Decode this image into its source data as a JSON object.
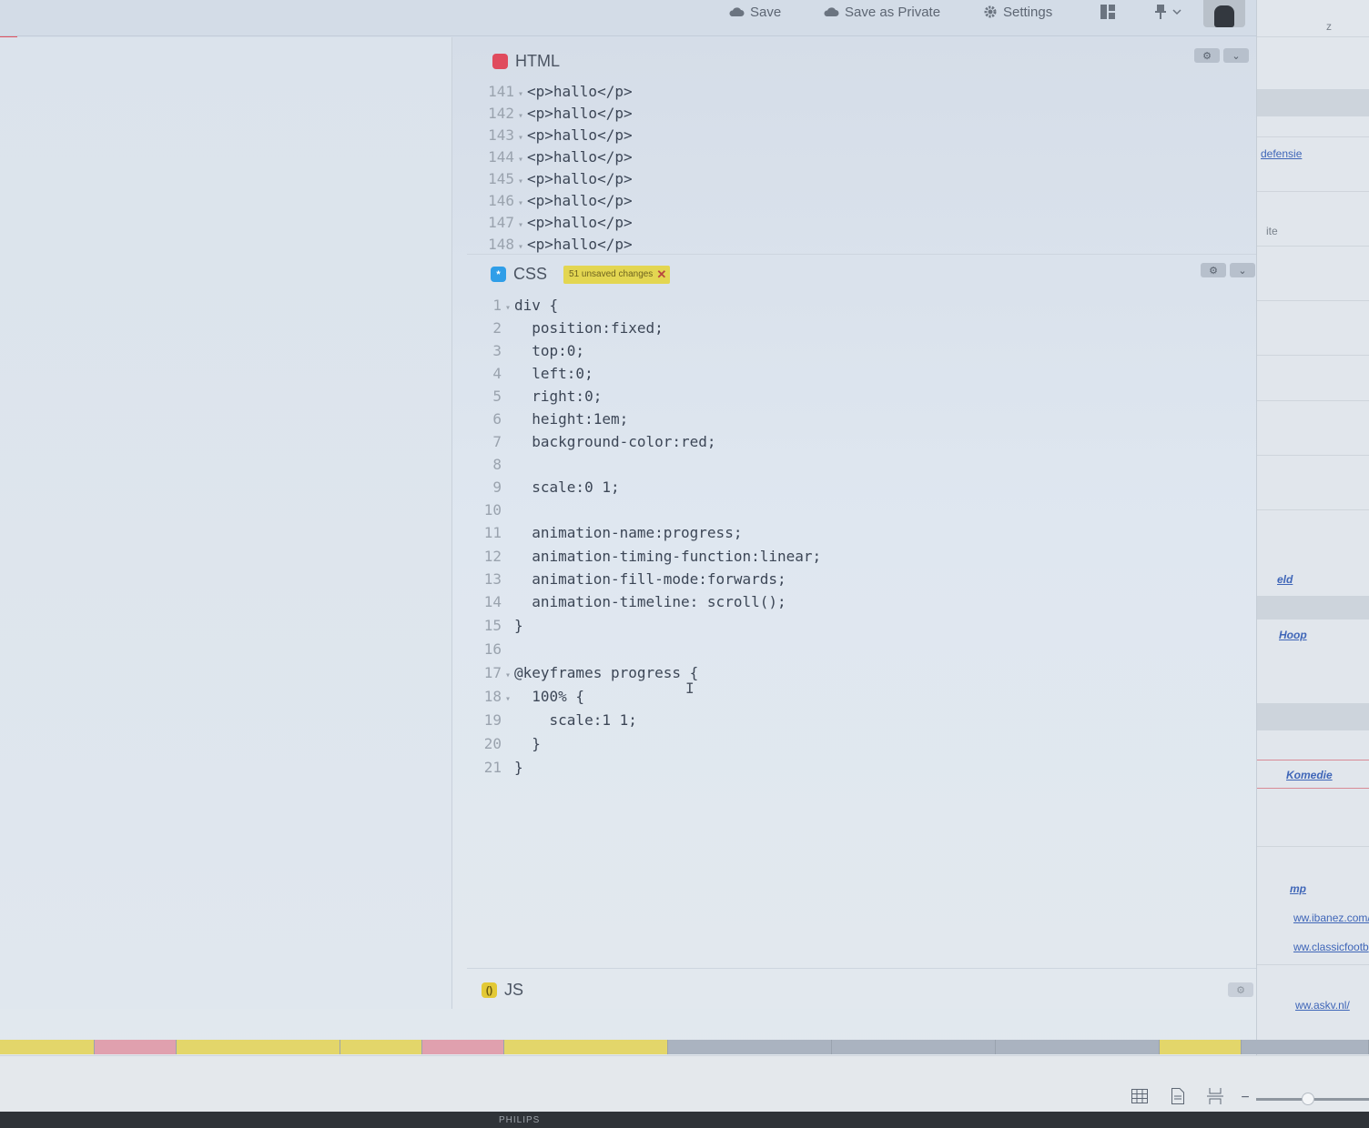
{
  "toolbar": {
    "save_label": "Save",
    "save_private_label": "Save as Private",
    "settings_label": "Settings"
  },
  "html_pane": {
    "title": "HTML",
    "lines": [
      {
        "num": "141",
        "code": "<p>hallo</p>"
      },
      {
        "num": "142",
        "code": "<p>hallo</p>"
      },
      {
        "num": "143",
        "code": "<p>hallo</p>"
      },
      {
        "num": "144",
        "code": "<p>hallo</p>"
      },
      {
        "num": "145",
        "code": "<p>hallo</p>"
      },
      {
        "num": "146",
        "code": "<p>hallo</p>"
      },
      {
        "num": "147",
        "code": "<p>hallo</p>"
      },
      {
        "num": "148",
        "code": "<p>hallo</p>"
      }
    ]
  },
  "css_pane": {
    "title": "CSS",
    "badge": "51 unsaved changes",
    "lines": [
      {
        "num": "1",
        "code": "div {"
      },
      {
        "num": "2",
        "code": "  position:fixed;"
      },
      {
        "num": "3",
        "code": "  top:0;"
      },
      {
        "num": "4",
        "code": "  left:0;"
      },
      {
        "num": "5",
        "code": "  right:0;"
      },
      {
        "num": "6",
        "code": "  height:1em;"
      },
      {
        "num": "7",
        "code": "  background-color:red;"
      },
      {
        "num": "8",
        "code": ""
      },
      {
        "num": "9",
        "code": "  scale:0 1;"
      },
      {
        "num": "10",
        "code": ""
      },
      {
        "num": "11",
        "code": "  animation-name:progress;"
      },
      {
        "num": "12",
        "code": "  animation-timing-function:linear;"
      },
      {
        "num": "13",
        "code": "  animation-fill-mode:forwards;"
      },
      {
        "num": "14",
        "code": "  animation-timeline: scroll();"
      },
      {
        "num": "15",
        "code": "}"
      },
      {
        "num": "16",
        "code": ""
      },
      {
        "num": "17",
        "code": "@keyframes progress {"
      },
      {
        "num": "18",
        "code": "  100% {"
      },
      {
        "num": "19",
        "code": "    scale:1 1;"
      },
      {
        "num": "20",
        "code": "  }"
      },
      {
        "num": "21",
        "code": "}"
      }
    ]
  },
  "js_pane": {
    "title": "JS"
  },
  "right_page": {
    "header_letter": "z",
    "links": [
      "defensie",
      "ite",
      "eld",
      "Hoop",
      "Komedie",
      "mp",
      "ww.ibanez.com/",
      "ww.classicfootb",
      "ww.askv.nl/"
    ]
  },
  "statusbar": {
    "minus": "−"
  },
  "brand": "PHILIPS",
  "colors": {
    "html_icon": "#e04b5d",
    "css_icon": "#2f9ee8",
    "js_icon": "#e3c935",
    "badge": "#e3d651",
    "strip": [
      "#e3d66a",
      "#e0a0ae",
      "#e3d66a",
      "#e3d66a",
      "#e0a0ae",
      "#e3d66a",
      "#aab3c0",
      "#aab3c0",
      "#aab3c0",
      "#e3d66a",
      "#aab3c0"
    ]
  }
}
